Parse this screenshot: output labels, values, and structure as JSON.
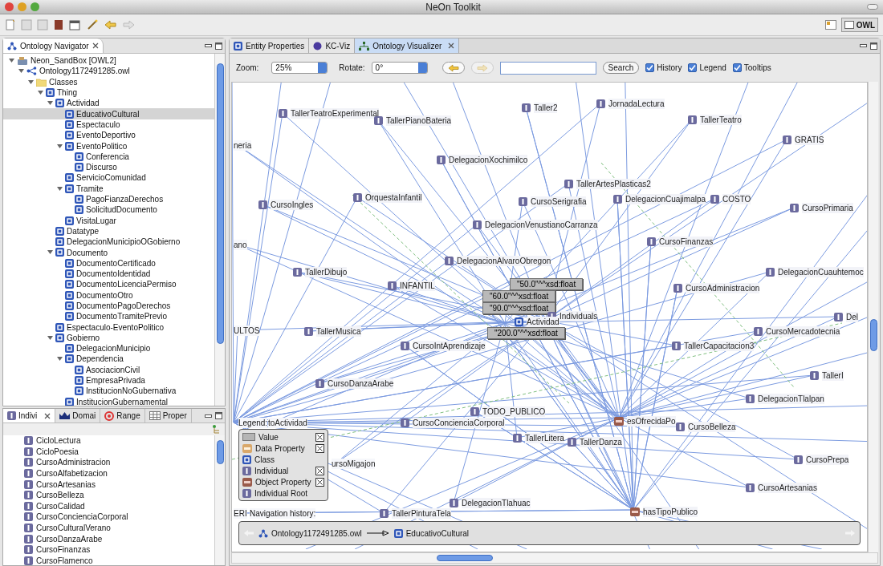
{
  "window": {
    "title": "NeOn Toolkit"
  },
  "perspective": {
    "label": "OWL"
  },
  "navigator": {
    "title": "Ontology Navigator",
    "tree": [
      {
        "label": "Neon_SandBox [OWL2]",
        "kind": "project",
        "expanded": true,
        "selected": false,
        "children": [
          {
            "label": "Ontology1172491285.owl",
            "kind": "ontology",
            "expanded": true,
            "selected": false,
            "children": [
              {
                "label": "Classes",
                "kind": "folder",
                "expanded": true,
                "selected": false,
                "children": [
                  {
                    "label": "Thing",
                    "kind": "class",
                    "expanded": true,
                    "selected": false,
                    "children": [
                      {
                        "label": "Actividad",
                        "kind": "class",
                        "expanded": true,
                        "selected": false,
                        "children": [
                          {
                            "label": "EducativoCultural",
                            "kind": "class",
                            "selected": true
                          },
                          {
                            "label": "Espectaculo",
                            "kind": "class",
                            "selected": false
                          },
                          {
                            "label": "EventoDeportivo",
                            "kind": "class",
                            "selected": false
                          },
                          {
                            "label": "EventoPolitico",
                            "kind": "class",
                            "expanded": true,
                            "selected": false,
                            "children": [
                              {
                                "label": "Conferencia",
                                "kind": "class",
                                "selected": false
                              },
                              {
                                "label": "Discurso",
                                "kind": "class",
                                "selected": false
                              }
                            ]
                          },
                          {
                            "label": "ServicioComunidad",
                            "kind": "class",
                            "selected": false
                          },
                          {
                            "label": "Tramite",
                            "kind": "class",
                            "expanded": true,
                            "selected": false,
                            "children": [
                              {
                                "label": "PagoFianzaDerechos",
                                "kind": "class",
                                "selected": false
                              },
                              {
                                "label": "SolicitudDocumento",
                                "kind": "class",
                                "selected": false
                              }
                            ]
                          },
                          {
                            "label": "VisitaLugar",
                            "kind": "class",
                            "selected": false
                          }
                        ]
                      },
                      {
                        "label": "Datatype",
                        "kind": "class",
                        "selected": false
                      },
                      {
                        "label": "DelegacionMunicipioOGobierno",
                        "kind": "class",
                        "selected": false
                      },
                      {
                        "label": "Documento",
                        "kind": "class",
                        "expanded": true,
                        "selected": false,
                        "children": [
                          {
                            "label": "DocumentoCertificado",
                            "kind": "class",
                            "selected": false
                          },
                          {
                            "label": "DocumentoIdentidad",
                            "kind": "class",
                            "selected": false
                          },
                          {
                            "label": "DocumentoLicenciaPermiso",
                            "kind": "class",
                            "selected": false
                          },
                          {
                            "label": "DocumentoOtro",
                            "kind": "class",
                            "selected": false
                          },
                          {
                            "label": "DocumentoPagoDerechos",
                            "kind": "class",
                            "selected": false
                          },
                          {
                            "label": "DocumentoTramitePrevio",
                            "kind": "class",
                            "selected": false
                          }
                        ]
                      },
                      {
                        "label": "Espectaculo-EventoPolitico",
                        "kind": "class",
                        "selected": false
                      },
                      {
                        "label": "Gobierno",
                        "kind": "class",
                        "expanded": true,
                        "selected": false,
                        "children": [
                          {
                            "label": "DelegacionMunicipio",
                            "kind": "class",
                            "selected": false
                          },
                          {
                            "label": "Dependencia",
                            "kind": "class",
                            "expanded": true,
                            "selected": false,
                            "children": [
                              {
                                "label": "AsociacionCivil",
                                "kind": "class",
                                "selected": false
                              },
                              {
                                "label": "EmpresaPrivada",
                                "kind": "class",
                                "selected": false
                              },
                              {
                                "label": "InstitucionNoGubernativa",
                                "kind": "class",
                                "selected": false
                              }
                            ]
                          },
                          {
                            "label": "InstitucionGubernamental",
                            "kind": "class",
                            "selected": false
                          }
                        ]
                      }
                    ]
                  }
                ]
              }
            ]
          }
        ]
      }
    ]
  },
  "side_panel": {
    "tabs": [
      {
        "label": "Indivi",
        "kind": "individual",
        "selected": true
      },
      {
        "label": "Domai",
        "kind": "domain",
        "selected": false
      },
      {
        "label": "Range",
        "kind": "range",
        "selected": false
      },
      {
        "label": "Proper",
        "kind": "property",
        "selected": false
      }
    ],
    "items": [
      "CicloLectura",
      "CicloPoesia",
      "CursoAdministracion",
      "CursoAlfabetizacion",
      "CursoArtesanias",
      "CursoBelleza",
      "CursoCalidad",
      "CursoConcienciaCorporal",
      "CursoCulturalVerano",
      "CursoDanzaArabe",
      "CursoFinanzas",
      "CursoFlamenco"
    ]
  },
  "editor_tabs": [
    {
      "label": "Entity Properties",
      "kind": "class",
      "selected": false
    },
    {
      "label": "KC-Viz",
      "kind": "kcviz",
      "selected": false
    },
    {
      "label": "Ontology Visualizer",
      "kind": "visualizer",
      "selected": true
    }
  ],
  "controls": {
    "zoom_label": "Zoom:",
    "zoom": "25%",
    "rotate_label": "Rotate:",
    "rotate": "0°",
    "back_disabled": false,
    "forward_disabled": true,
    "search_button": "Search",
    "checkboxes": [
      {
        "label": "History",
        "checked": true
      },
      {
        "label": "Legend",
        "checked": true
      },
      {
        "label": "Tooltips",
        "checked": true
      }
    ]
  },
  "graph_nodes": [
    {
      "label": "TallerTeatroExperimental",
      "kind": "individual"
    },
    {
      "label": "TallerPianoBateria",
      "kind": "individual"
    },
    {
      "label": "Taller2",
      "kind": "individual"
    },
    {
      "label": "JornadaLectura",
      "kind": "individual"
    },
    {
      "label": "TallerTeatro",
      "kind": "individual"
    },
    {
      "label": "GRATIS",
      "kind": "individual"
    },
    {
      "label": "neria",
      "kind": "clipped"
    },
    {
      "label": "DelegacionXochimilco",
      "kind": "individual"
    },
    {
      "label": "OrquestaInfantil",
      "kind": "individual"
    },
    {
      "label": "CursoIngles",
      "kind": "individual"
    },
    {
      "label": "TallerArtesPlasticas2",
      "kind": "individual"
    },
    {
      "label": "CursoSerigrafia",
      "kind": "individual"
    },
    {
      "label": "DelegacionCuajimalpa",
      "kind": "individual"
    },
    {
      "label": "COSTO",
      "kind": "individual"
    },
    {
      "label": "CursoPrimaria",
      "kind": "individual"
    },
    {
      "label": "DelegacionVenustianoCarranza",
      "kind": "individual"
    },
    {
      "label": "ano",
      "kind": "clipped"
    },
    {
      "label": "CursoFinanzas",
      "kind": "individual"
    },
    {
      "label": "DelegacionAlvaroObregon",
      "kind": "individual"
    },
    {
      "label": "TallerDibujo",
      "kind": "individual"
    },
    {
      "label": "DelegacionCuauhtemoc",
      "kind": "individual"
    },
    {
      "label": "INFANTIL",
      "kind": "individual"
    },
    {
      "label": "CursoAdministracion",
      "kind": "individual"
    },
    {
      "label": "ULTOS",
      "kind": "clipped"
    },
    {
      "label": "TallerMusica",
      "kind": "individual"
    },
    {
      "label": "CursoMercadotecnia",
      "kind": "individual"
    },
    {
      "label": "Del",
      "kind": "individual"
    },
    {
      "label": "CursoIntAprendizaje",
      "kind": "individual"
    },
    {
      "label": "TallerCapacitacion3",
      "kind": "individual"
    },
    {
      "label": "CursoDanzaArabe",
      "kind": "individual"
    },
    {
      "label": "TallerI",
      "kind": "individual"
    },
    {
      "label": "DelegacionTlalpan",
      "kind": "individual"
    },
    {
      "label": "TODO_PUBLICO",
      "kind": "individual"
    },
    {
      "label": "CursoConcienciaCorporal",
      "kind": "individual"
    },
    {
      "label": "esOfrecidaPo",
      "kind": "object_property"
    },
    {
      "label": "CursoBelleza",
      "kind": "individual"
    },
    {
      "label": "TallerLitera",
      "kind": "individual"
    },
    {
      "label": "TallerDanza",
      "kind": "individual"
    },
    {
      "label": "CursoPrepa",
      "kind": "individual"
    },
    {
      "label": "ursoMigajon",
      "kind": "clipped"
    },
    {
      "label": "CursoArtesanias",
      "kind": "individual"
    },
    {
      "label": "DelegacionTlahuac",
      "kind": "individual"
    },
    {
      "label": "ERI",
      "kind": "clipped"
    },
    {
      "label": "TallerPinturaTela",
      "kind": "individual"
    },
    {
      "label": "hasTipoPublico",
      "kind": "object_property"
    },
    {
      "label": "\"50.0\"^^xsd:float",
      "kind": "value"
    },
    {
      "label": "\"60.0\"^^xsd:float",
      "kind": "value"
    },
    {
      "label": "\"90.0\"^^xsd:float",
      "kind": "value"
    },
    {
      "label": "Individuals",
      "kind": "individual"
    },
    {
      "label": "Actividad",
      "kind": "class"
    },
    {
      "label": "\"200.0\"^^xsd:float",
      "kind": "value"
    },
    {
      "label": "toActividad",
      "kind": "clipped"
    }
  ],
  "legend": {
    "title": "Legend:",
    "items": [
      {
        "label": "Value",
        "kind": "value",
        "checked": true
      },
      {
        "label": "Data Property",
        "kind": "data_property",
        "checked": true
      },
      {
        "label": "Class",
        "kind": "class",
        "checked": false
      },
      {
        "label": "Individual",
        "kind": "individual",
        "checked": true
      },
      {
        "label": "Object Property",
        "kind": "object_property",
        "checked": true
      },
      {
        "label": "Individual Root",
        "kind": "individual",
        "checked": false
      }
    ]
  },
  "history": {
    "title": "Navigation history:",
    "items": [
      {
        "label": "Ontology1172491285.owl",
        "kind": "ontology"
      },
      {
        "label": "EducativoCultural",
        "kind": "class"
      }
    ]
  }
}
